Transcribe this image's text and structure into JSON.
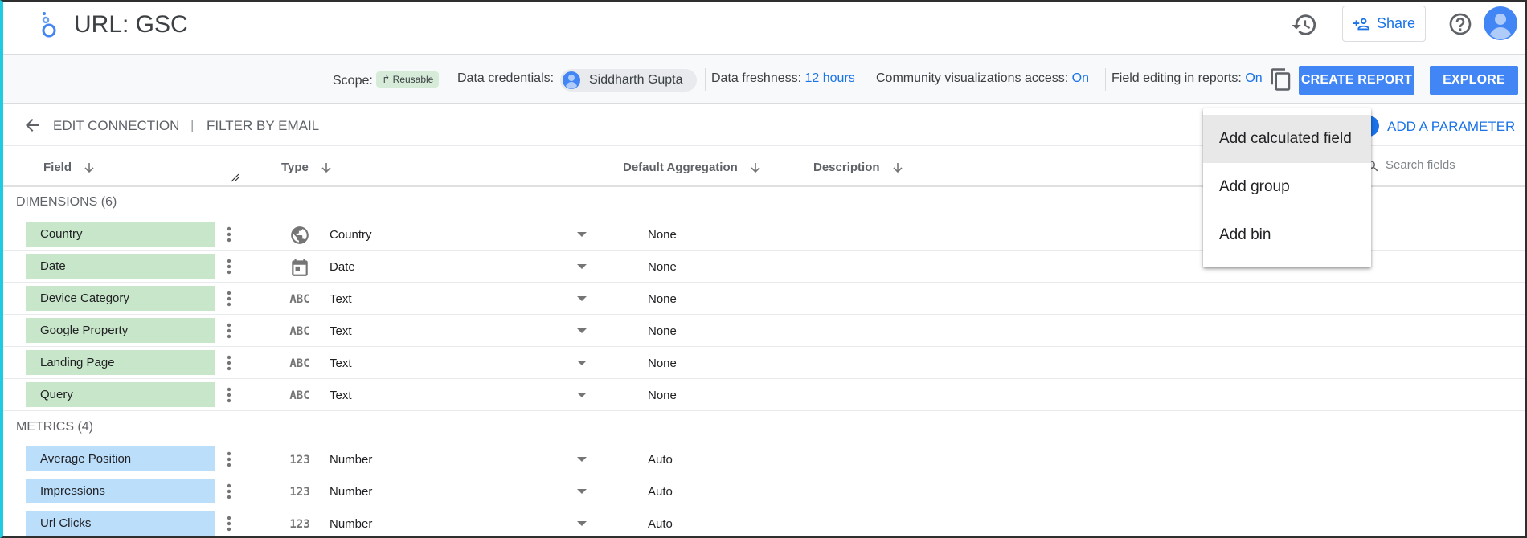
{
  "app": {
    "title": "URL: GSC"
  },
  "header": {
    "share_label": "Share"
  },
  "infobar": {
    "scope_label": "Scope:",
    "scope_chip": "Reusable",
    "credentials_label": "Data credentials:",
    "credentials_user": "Siddharth Gupta",
    "freshness_label": "Data freshness:",
    "freshness_value": "12 hours",
    "community_label": "Community visualizations access:",
    "community_value": "On",
    "field_editing_label": "Field editing in reports:",
    "field_editing_value": "On",
    "create_report": "CREATE REPORT",
    "explore": "EXPLORE"
  },
  "toolbar": {
    "edit_connection": "EDIT CONNECTION",
    "separator": "|",
    "filter_by_email": "FILTER BY EMAIL",
    "add_parameter": "ADD A PARAMETER"
  },
  "columns": {
    "field": "Field",
    "type": "Type",
    "default_aggregation": "Default Aggregation",
    "description": "Description"
  },
  "search": {
    "placeholder": "Search fields"
  },
  "dimensions": {
    "label": "DIMENSIONS (6)",
    "rows": [
      {
        "name": "Country",
        "type": "Country",
        "icon": "globe-icon",
        "aggregation": "None"
      },
      {
        "name": "Date",
        "type": "Date",
        "icon": "calendar-icon",
        "aggregation": "None"
      },
      {
        "name": "Device Category",
        "type": "Text",
        "icon": "abc-icon",
        "aggregation": "None"
      },
      {
        "name": "Google Property",
        "type": "Text",
        "icon": "abc-icon",
        "aggregation": "None"
      },
      {
        "name": "Landing Page",
        "type": "Text",
        "icon": "abc-icon",
        "aggregation": "None"
      },
      {
        "name": "Query",
        "type": "Text",
        "icon": "abc-icon",
        "aggregation": "None"
      }
    ]
  },
  "metrics": {
    "label": "METRICS (4)",
    "rows": [
      {
        "name": "Average Position",
        "type": "Number",
        "icon": "number-icon",
        "aggregation": "Auto"
      },
      {
        "name": "Impressions",
        "type": "Number",
        "icon": "number-icon",
        "aggregation": "Auto"
      },
      {
        "name": "Url Clicks",
        "type": "Number",
        "icon": "number-icon",
        "aggregation": "Auto"
      }
    ]
  },
  "type_icon_glyphs": {
    "abc": "ABC",
    "number": "123"
  },
  "menu": {
    "items": [
      "Add calculated field",
      "Add group",
      "Add bin"
    ],
    "highlighted": "Add calculated field"
  },
  "colors": {
    "accent": "#1a73e8",
    "button": "#4285f4",
    "dimension_chip": "#c8e6c9",
    "metric_chip": "#bbdefb"
  }
}
